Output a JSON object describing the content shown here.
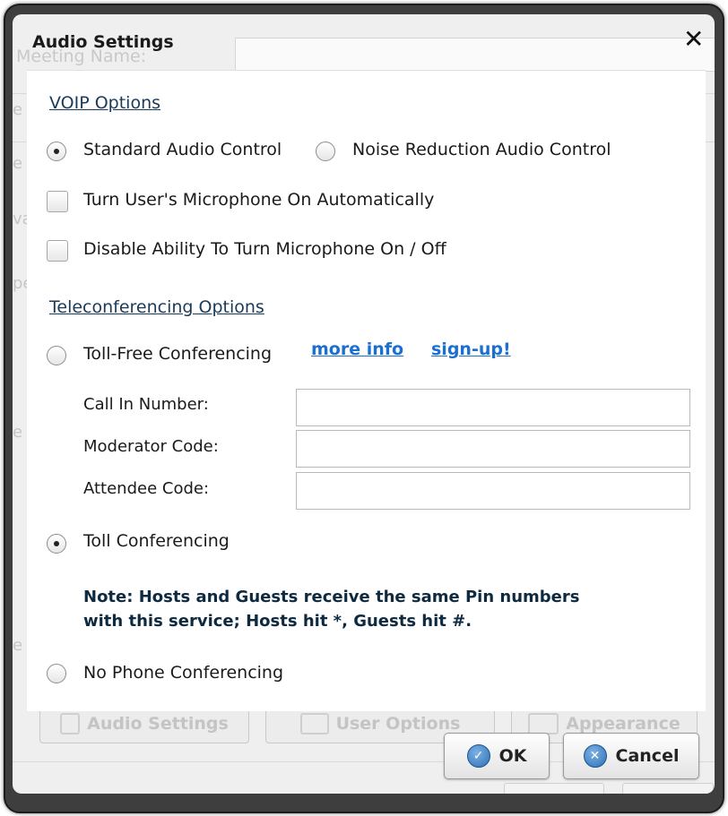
{
  "background": {
    "meeting_name_label": "Meeting Name:",
    "tabs": [
      {
        "label": "Audio Settings"
      },
      {
        "label": "User Options"
      },
      {
        "label": "Appearance"
      }
    ]
  },
  "dialog": {
    "title": "Audio Settings",
    "close_glyph": "✕",
    "voip": {
      "heading": "VOIP Options",
      "standard_label": "Standard Audio Control",
      "noise_label": "Noise Reduction Audio Control",
      "mic_auto_label": "Turn User's Microphone On Automatically",
      "disable_mic_label": "Disable Ability To Turn Microphone On / Off"
    },
    "tele": {
      "heading": "Teleconferencing Options",
      "toll_free_label": "Toll-Free Conferencing",
      "more_info_link": "more info",
      "signup_link": "sign-up!",
      "call_in_label": "Call In Number:",
      "call_in_value": "",
      "moderator_label": "Moderator Code:",
      "moderator_value": "",
      "attendee_label": "Attendee Code:",
      "attendee_value": "",
      "toll_label": "Toll Conferencing",
      "note_line1": "Note: Hosts and Guests receive the same Pin numbers",
      "note_line2": "with this service; Hosts hit *, Guests hit #.",
      "no_phone_label": "No Phone Conferencing"
    },
    "selected": {
      "voip": "standard",
      "tele": "toll",
      "mic_auto": false,
      "disable_mic": false
    }
  },
  "buttons": {
    "ok_label": "OK",
    "cancel_label": "Cancel"
  },
  "colors": {
    "link": "#1b6fd0",
    "heading": "#1a3a5c",
    "button_icon": "#2d6fb3"
  }
}
